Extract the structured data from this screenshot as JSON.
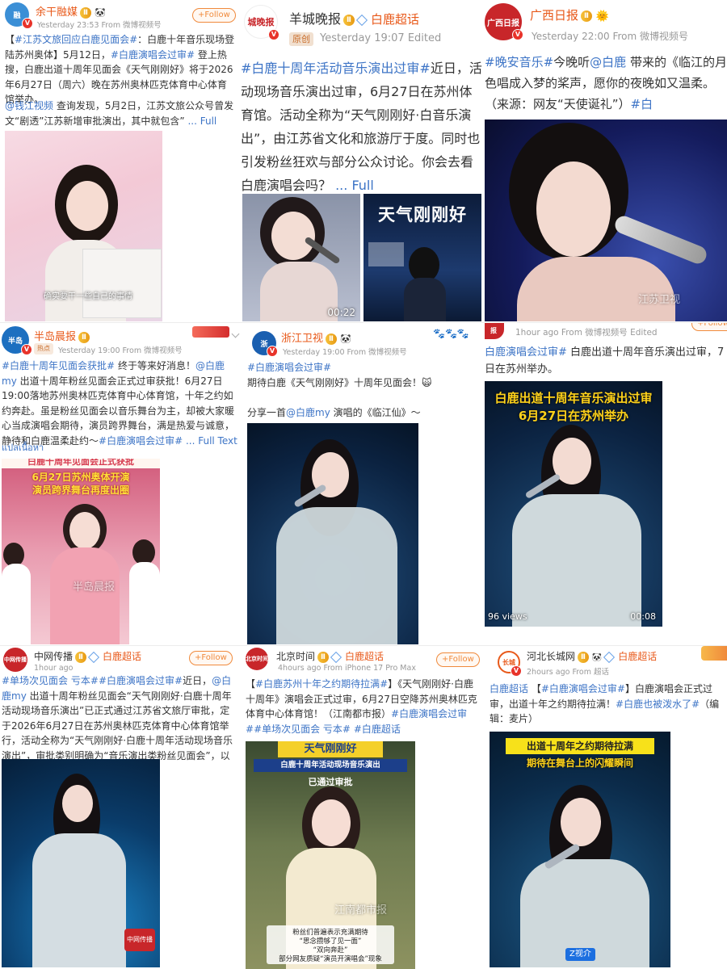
{
  "posts": [
    {
      "account": "余干融媒",
      "rank": "Ⅱ",
      "meta": "Yesterday 23:53  From 微博视频号",
      "follow": "+Follow",
      "text_html": "【<span class='tag'>#江苏文旅回应白鹿见面会#</span>：白鹿十年音乐现场登陆苏州奥体】5月12日，<span class='tag'>#白鹿演唱会过审#</span> 登上热搜，白鹿出道十周年见面会《天气刚刚好》将于2026年6月27日（周六）晚在苏州奥林匹克体育中心体育馆举办。",
      "text2_html": "<span class='at'>@钱江视频</span> 查询发现，5月2日，江苏文旅公众号曾发文“剧透”江苏新增审批演出，其中就包含” <span class='full'>... Full Text</span>",
      "caption": "确实要干一些自己的事情"
    },
    {
      "account": "羊城晚报",
      "rank": "Ⅱ",
      "chaohua": "白鹿超话",
      "original": "原创",
      "meta": "Yesterday 19:07   Edited",
      "text_html": "<span class='tag'>#白鹿十周年活动音乐演出过审#</span>近日，活动现场音乐演出过审，6月27日在苏州体育馆。活动全称为“天气刚刚好·白音乐演出”，由江苏省文化和旅游厅于度。同时也引发粉丝狂欢与部分公众讨论。你会去看白鹿演唱会吗？ <span class='full'>... Full</span>",
      "duration": "00:22",
      "poster_title": "天气刚刚好"
    },
    {
      "account": "广西日报",
      "meta": "Yesterday 22:00   From 微博视频号",
      "text_html": "<span class='tag'>#晚安音乐#</span>今晚听<span class='at'>@白鹿</span> 带来的《临江的月色唱成入梦的桨声，愿你的夜晚如又温柔。（来源：网友“天使诞礼”）<span class='tag'>#白</span>",
      "watermark": "江苏卫视"
    },
    {
      "account": "半岛晨报",
      "rank": "Ⅱ",
      "hot": "热点",
      "meta": "Yesterday 19:00  From 微博视频号",
      "text_html": "<span class='tag'>#白鹿十周年见面会获批#</span> 终于等来好消息！<span class='at'>@白鹿my</span> 出道十周年粉丝见面会正式过审获批！6月27日19:00落地苏州奥林匹克体育中心体育馆，十年之约如约奔赴。虽是粉丝见面会以音乐舞台为主，却被大家暖心当成演唱会期待，演员跨界舞台，满是热爱与诚意，静待和白鹿温柔赴约～<span class='tag'>#白鹿演唱会过审#</span> <span class='full'>... Full Text</span>",
      "translate": "แปลเนื้อหา",
      "banner1": "白鹿十周年见面会正式获批",
      "banner2": "6月27日苏州奥体开演",
      "banner3": "演员跨界舞台再度出圈",
      "watermark": "半岛晨报"
    },
    {
      "account": "浙江卫视",
      "rank": "Ⅱ",
      "meta": "Yesterday 19:00   From 微博视频号",
      "text_html": "<span class='tag'>#白鹿演唱会过审#</span><br>期待白鹿《天气刚刚好》十周年见面会！🙀<br><br>分享一首<span class='at'>@白鹿my</span> 演唱的《临江仙》～"
    },
    {
      "account": "",
      "meta": "1hour ago   From 微博视频号   Edited",
      "follow": "+Follow",
      "text_html": "<span class='tag'>白鹿演唱会过审#</span> 白鹿出道十周年音乐演出过审，7日在苏州举办。",
      "banner1": "白鹿出道十周年音乐演出过审",
      "banner2": "6月27日在苏州举办",
      "views": "96 views",
      "duration": "00:08"
    },
    {
      "account": "中网传播",
      "rank": "Ⅱ",
      "chaohua": "白鹿超话",
      "meta": "1hour ago",
      "follow": "+Follow",
      "text_html": "<span class='tag'>#单场次见面会 亏本#</span><span class='tag'>#白鹿演唱会过审#</span>近日，<span class='at'>@白鹿my</span> 出道十周年粉丝见面会“天气刚刚好·白鹿十周年活动现场音乐演出”已正式通过江苏省文旅厅审批，定于2026年6月27日在苏州奥林匹克体育中心体育馆举行，活动全称为“天气刚刚好·白鹿十周年活动现场音乐演出”，审批类别明确为“音乐演出类粉丝见面会”，以歌 <span class='full'>... Full Text</span>",
      "logo": "中网传播"
    },
    {
      "account": "北京时间",
      "rank": "Ⅱ",
      "chaohua": "白鹿超话",
      "meta": "4hours ago   From iPhone 17 Pro Max",
      "follow": "+Follow",
      "text_html": "【<span class='tag'>#白鹿苏州十年之约期待拉满#</span>】《天气刚刚好·白鹿十周年》演唱会正式过审，6月27日空降苏州奥林匹克体育中心体育馆！（江南都市报）<span class='tag'>#白鹿演唱会过审#</span><span class='tag'>#单场次见面会 亏本#</span> <span class='tag'>#白鹿超话</span>",
      "banner1": "天气刚刚好",
      "banner2": "白鹿十周年活动现场音乐演出",
      "banner3": "已通过审批",
      "sub1": "粉丝们普遍表示充满期待",
      "sub2": "“思念攒够了见一面”",
      "sub3": "“双向奔赴”",
      "sub4": "部分网友质疑“演员开演唱会”现象",
      "watermark": "江南都市报"
    },
    {
      "account": "河北长城网",
      "rank": "Ⅱ",
      "chaohua": "白鹿超话",
      "meta": "2hours ago   From 超话",
      "text_html": "<span class='tag'>白鹿超话</span> 【<span class='tag'>#白鹿演唱会过审#</span>】白鹿演唱会正式过审，出道十年之约期待拉满！<span class='tag'>#白鹿也被泼水了#</span>（编辑：麦片）",
      "banner1": "出道十周年之约期待拉满",
      "banner2": "期待在舞台上的闪耀瞬间",
      "watermark": "Z视介"
    }
  ],
  "colors": {
    "link": "#3d74c6",
    "orange_name": "#e8591a",
    "meta": "#999999"
  }
}
